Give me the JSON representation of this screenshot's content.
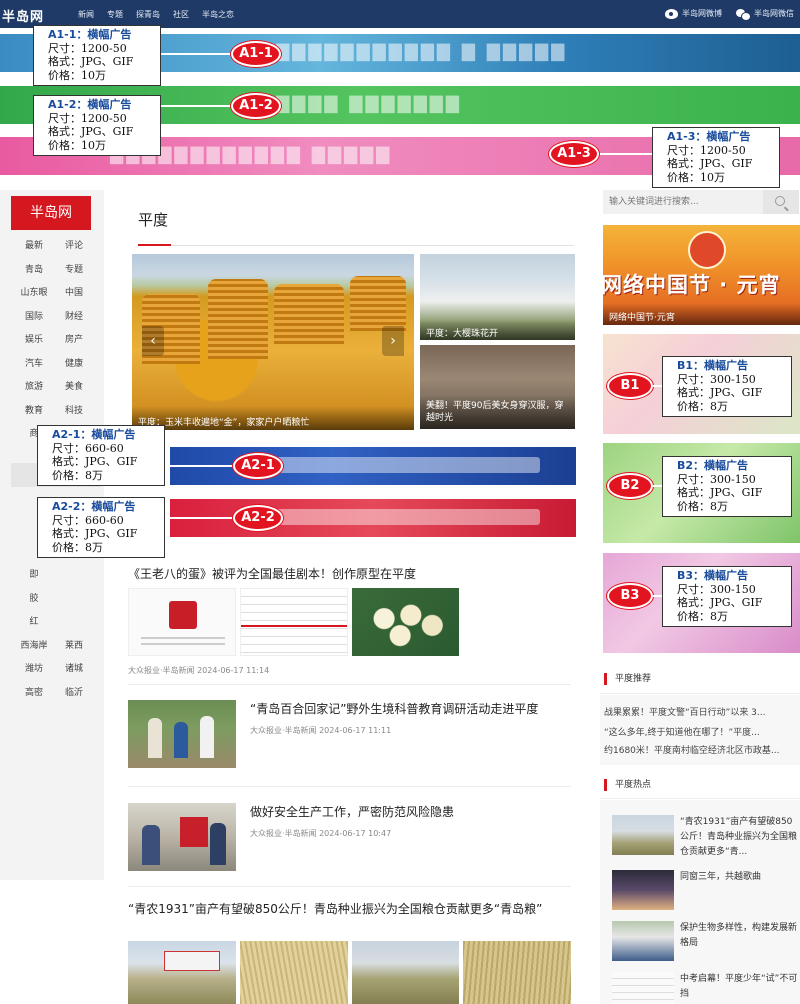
{
  "topbar": {
    "logo": "半岛网",
    "nav": [
      "新闻",
      "专题",
      "探青岛",
      "社区",
      "半岛之恋"
    ],
    "links": [
      {
        "label": "半岛网微博",
        "icon": "weibo-icon"
      },
      {
        "label": "半岛网微信",
        "icon": "wechat-icon"
      }
    ]
  },
  "ads": {
    "a1_1": {
      "tag": "A1-1",
      "title": "A1-1：横幅广告",
      "size": "尺寸：1200-50",
      "format": "格式：JPG、GIF",
      "price": "价格：10万",
      "banner_text": "..."
    },
    "a1_2": {
      "tag": "A1-2",
      "title": "A1-2：横幅广告",
      "size": "尺寸：1200-50",
      "format": "格式：JPG、GIF",
      "price": "价格：10万"
    },
    "a1_3": {
      "tag": "A1-3",
      "title": "A1-3：横幅广告",
      "size": "尺寸：1200-50",
      "format": "格式：JPG、GIF",
      "price": "价格：10万"
    },
    "a2_1": {
      "tag": "A2-1",
      "title": "A2-1：横幅广告",
      "size": "尺寸：660-60",
      "format": "格式：JPG、GIF",
      "price": "价格：8万"
    },
    "a2_2": {
      "tag": "A2-2",
      "title": "A2-2：横幅广告",
      "size": "尺寸：660-60",
      "format": "格式：JPG、GIF",
      "price": "价格：8万"
    },
    "b1": {
      "tag": "B1",
      "title": "B1：横幅广告",
      "size": "尺寸：300-150",
      "format": "格式：JPG、GIF",
      "price": "价格：8万"
    },
    "b2": {
      "tag": "B2",
      "title": "B2：横幅广告",
      "size": "尺寸：300-150",
      "format": "格式：JPG、GIF",
      "price": "价格：8万"
    },
    "b3": {
      "tag": "B3",
      "title": "B3：横幅广告",
      "size": "尺寸：300-150",
      "format": "格式：JPG、GIF",
      "price": "价格：8万"
    }
  },
  "leftnav": {
    "brand": "半岛网",
    "items_top": [
      "最新",
      "评论",
      "青岛",
      "专题",
      "山东眼",
      "中国",
      "国际",
      "财经",
      "娱乐",
      "房产",
      "汽车",
      "健康",
      "旅游",
      "美食",
      "教育",
      "科技",
      "商",
      ""
    ],
    "items_bottom": [
      "即",
      "",
      "胶",
      "",
      "红",
      "",
      "西海岸",
      "莱西",
      "潍坊",
      "诸城",
      "高密",
      "临沂"
    ]
  },
  "main": {
    "title": "平度",
    "slider": {
      "main_caption": "平度：玉米丰收遍地“金”，家家户户晒粮忙",
      "side1_caption": "平度：大樱珠花开",
      "side2_caption": "美翻！平度90后美女身穿汉服，穿越时光"
    },
    "news": [
      {
        "title": "《王老八的蛋》被评为全国最佳剧本！创作原型在平度",
        "meta": "大众报业·半岛新闻 2024-06-17 11:14"
      },
      {
        "title": "“青岛百合回家记”野外生境科普教育调研活动走进平度",
        "meta": "大众报业·半岛新闻 2024-06-17 11:11"
      },
      {
        "title": "做好安全生产工作，严密防范风险隐患",
        "meta": "大众报业·半岛新闻 2024-06-17 10:47"
      },
      {
        "title": "“青农1931”亩产有望破850公斤！青岛种业振兴为全国粮仓贡献更多“青岛粮”",
        "meta": ""
      }
    ]
  },
  "right": {
    "search_placeholder": "输入关键词进行搜索...",
    "festival_text": "网络中国节 · 元宵",
    "festival_caption": "网络中国节·元宵",
    "recommend_title": "平度推荐",
    "recommend": [
      "战果累累！平度文警“百日行动”以来 3...",
      "“这么多年,终于知道他在哪了！”平度...",
      "约1680米！平度南村临空经济北区市政基..."
    ],
    "hot_title": "平度热点",
    "hot": [
      "“青农1931”亩产有望破850公斤！青岛种业振兴为全国粮仓贡献更多“青...",
      "同窗三年，共越歌曲",
      "保护生物多样性，构建发展新格局",
      "中考启幕！平度少年“试”不可挡"
    ]
  }
}
